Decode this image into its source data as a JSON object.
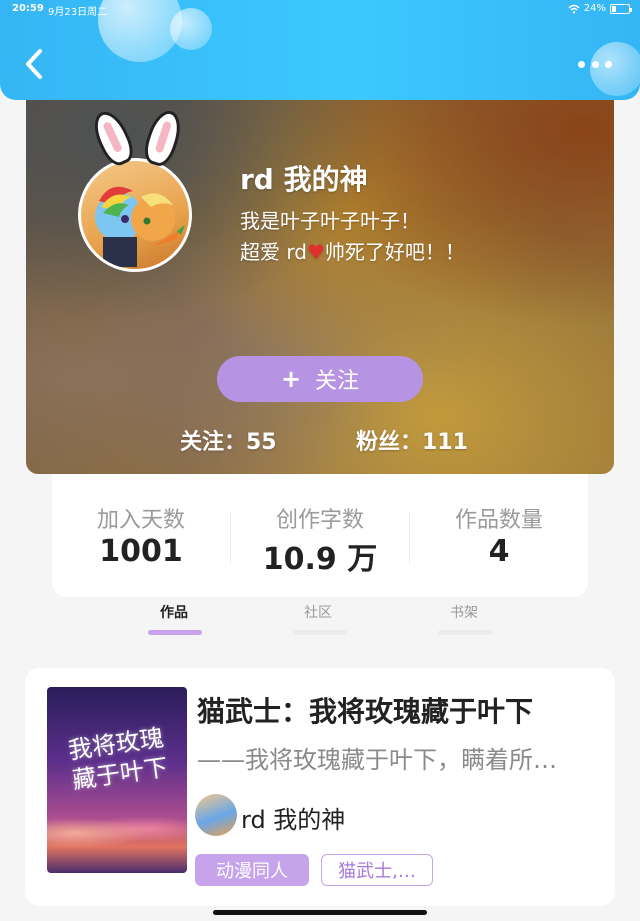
{
  "status_bar": {
    "time": "20:59",
    "date": "9月23日周二",
    "battery": "24%",
    "battery_level": 0.24
  },
  "header": {
    "back_icon": "chevron-left-icon",
    "more_icon": "more-dots-icon"
  },
  "profile": {
    "username": "rd 我的神",
    "bio_line1": "我是叶子叶子叶子！",
    "bio_line2_prefix": "超爱 rd",
    "bio_line2_suffix": "帅死了好吧！！",
    "follow_button": {
      "icon": "+",
      "label": "关注"
    },
    "following_text": "关注：55",
    "fans_text": "粉丝：111"
  },
  "stats": [
    {
      "label": "加入天数",
      "value": "1001"
    },
    {
      "label": "创作字数",
      "value": "10.9 万"
    },
    {
      "label": "作品数量",
      "value": "4"
    }
  ],
  "tabs": [
    {
      "label": "作品",
      "active": true
    },
    {
      "label": "社区",
      "active": false
    },
    {
      "label": "书架",
      "active": false
    }
  ],
  "works": [
    {
      "cover_text": "我将玫瑰藏于叶下",
      "title": "猫武士：我将玫瑰藏于叶下",
      "subtitle": "——我将玫瑰藏于叶下，瞒着所…",
      "author": "rd 我的神",
      "tags": [
        "动漫同人",
        "猫武士,…"
      ]
    }
  ],
  "colors": {
    "header": "#3cc8ff",
    "accent": "#b793e4",
    "tag_fill": "#c7a3ec",
    "tag_outline_text": "#a77bdb",
    "indicator_active": "#c7a3ec",
    "indicator_inactive": "#ececec"
  }
}
